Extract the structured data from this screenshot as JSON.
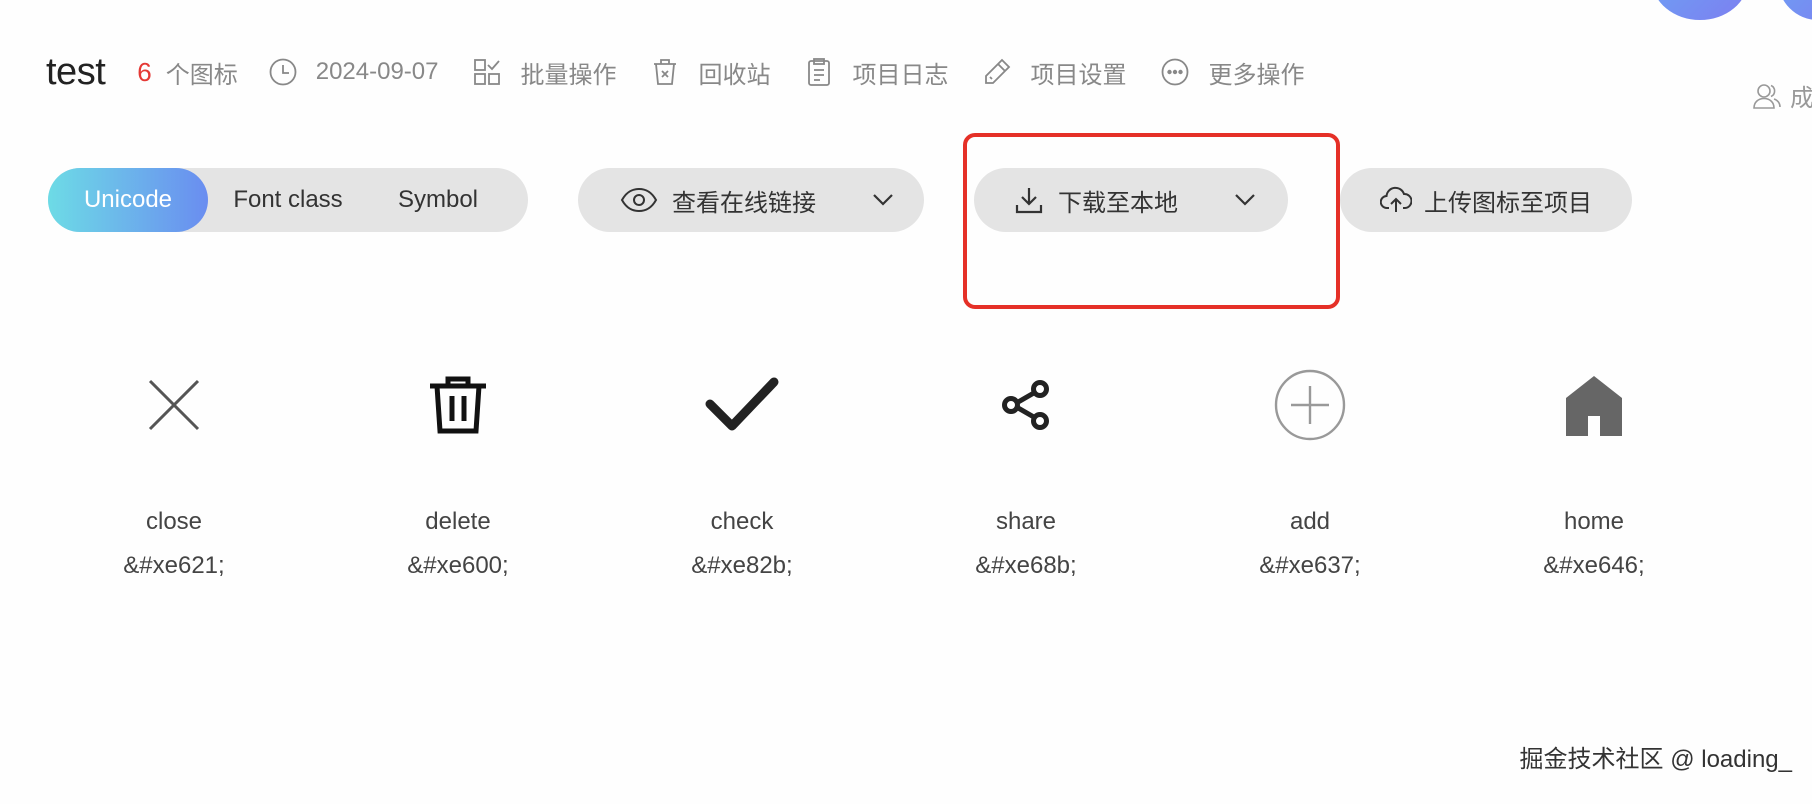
{
  "header": {
    "title": "test",
    "icon_count": "6",
    "icon_count_label": "个图标",
    "date": "2024-09-07",
    "batch": "批量操作",
    "recycle": "回收站",
    "log": "项目日志",
    "settings": "项目设置",
    "more": "更多操作"
  },
  "member_label": "成",
  "format_tabs": {
    "unicode": "Unicode",
    "font_class": "Font class",
    "symbol": "Symbol"
  },
  "toolbar": {
    "view_online": "查看在线链接",
    "download": "下载至本地",
    "upload": "上传图标至项目"
  },
  "icons": [
    {
      "name": "close",
      "code": "&#xe621;",
      "icon": "close-icon"
    },
    {
      "name": "delete",
      "code": "&#xe600;",
      "icon": "delete-icon"
    },
    {
      "name": "check",
      "code": "&#xe82b;",
      "icon": "check-icon"
    },
    {
      "name": "share",
      "code": "&#xe68b;",
      "icon": "share-icon"
    },
    {
      "name": "add",
      "code": "&#xe637;",
      "icon": "add-icon"
    },
    {
      "name": "home",
      "code": "&#xe646;",
      "icon": "home-icon"
    }
  ],
  "watermark": "掘金技术社区 @ loading_",
  "colors": {
    "accent_start": "#6ddbe6",
    "accent_end": "#6a8df0",
    "count": "#e53935",
    "highlight": "#e53027"
  }
}
